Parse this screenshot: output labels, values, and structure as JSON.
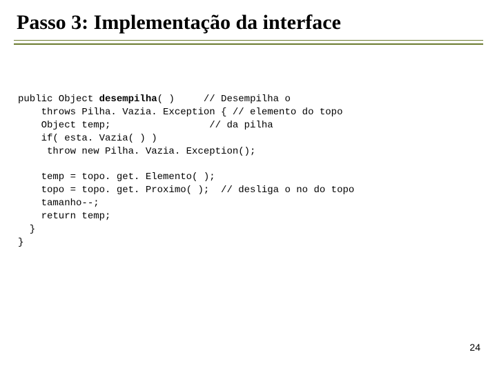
{
  "title": "Passo 3:  Implementação da interface",
  "code": {
    "l1a": "public Object ",
    "l1b": "desempilha",
    "l1c": "( )     // Desempilha o",
    "l2": "    throws Pilha. Vazia. Exception { // elemento do topo",
    "l3": "    Object temp;                 // da pilha",
    "l4": "    if( esta. Vazia( ) )",
    "l5": "     throw new Pilha. Vazia. Exception();",
    "l6": "",
    "l7": "    temp = topo. get. Elemento( );",
    "l8": "    topo = topo. get. Proximo( );  // desliga o no do topo",
    "l9": "    tamanho--;",
    "l10": "    return temp;",
    "l11": "  }",
    "l12": "}"
  },
  "page_number": "24"
}
